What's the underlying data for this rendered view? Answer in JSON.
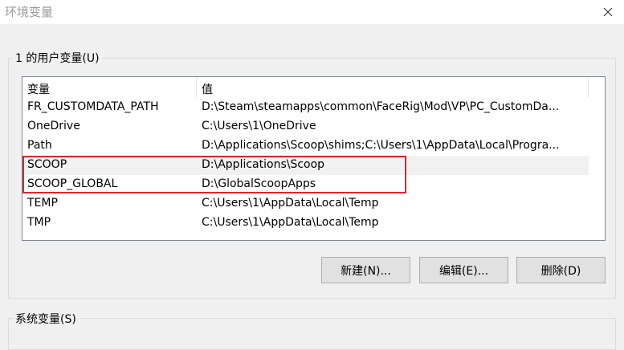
{
  "window": {
    "title": "环境变量"
  },
  "user_vars": {
    "group_label": "1 的用户变量(U)",
    "columns": [
      "变量",
      "值"
    ],
    "rows": [
      {
        "name": "FR_CUSTOMDATA_PATH",
        "value": "D:\\Steam\\steamapps\\common\\FaceRig\\Mod\\VP\\PC_CustomDa..."
      },
      {
        "name": "OneDrive",
        "value": "C:\\Users\\1\\OneDrive"
      },
      {
        "name": "Path",
        "value": "D:\\Applications\\Scoop\\shims;C:\\Users\\1\\AppData\\Local\\Progra..."
      },
      {
        "name": "SCOOP",
        "value": "D:\\Applications\\Scoop"
      },
      {
        "name": "SCOOP_GLOBAL",
        "value": "D:\\GlobalScoopApps"
      },
      {
        "name": "TEMP",
        "value": "C:\\Users\\1\\AppData\\Local\\Temp"
      },
      {
        "name": "TMP",
        "value": "C:\\Users\\1\\AppData\\Local\\Temp"
      }
    ],
    "buttons": {
      "new": "新建(N)...",
      "edit": "编辑(E)...",
      "delete": "删除(D)"
    }
  },
  "system_vars": {
    "group_label": "系统变量(S)"
  },
  "colors": {
    "highlight_border": "#d9262c",
    "row_hover": "#f1f1f1"
  },
  "icons": {
    "close": "close-icon"
  }
}
